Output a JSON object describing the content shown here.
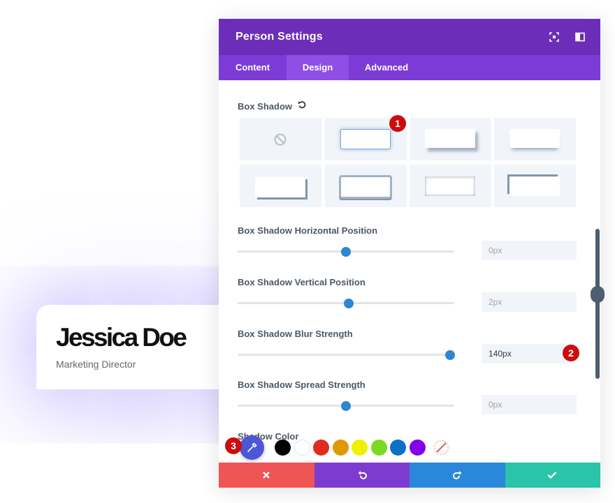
{
  "card": {
    "name": "Jessica Doe",
    "role": "Marketing Director"
  },
  "modal": {
    "title": "Person Settings",
    "header_icons": [
      "fullscreen-icon",
      "sidebar-toggle-icon"
    ],
    "tabs": [
      {
        "label": "Content",
        "active": false
      },
      {
        "label": "Design",
        "active": true
      },
      {
        "label": "Advanced",
        "active": false
      }
    ]
  },
  "box_shadow": {
    "label": "Box Shadow",
    "reset_icon": "reset-icon",
    "presets": [
      "none",
      "preset-1",
      "preset-2",
      "preset-3",
      "preset-4",
      "preset-5",
      "preset-6",
      "preset-7"
    ],
    "selected_preset": "preset-1"
  },
  "fields": {
    "horizontal": {
      "label": "Box Shadow Horizontal Position",
      "value": "0px",
      "slider_fraction": 0.5
    },
    "vertical": {
      "label": "Box Shadow Vertical Position",
      "value": "2px",
      "slider_fraction": 0.51
    },
    "blur": {
      "label": "Box Shadow Blur Strength",
      "value": "140px",
      "slider_fraction": 0.985
    },
    "spread": {
      "label": "Box Shadow Spread Strength",
      "value": "0px",
      "slider_fraction": 0.5
    }
  },
  "shadow_color": {
    "label": "Shadow Color",
    "swatches": [
      "#000000",
      "#ffffff",
      "#e02b20",
      "#e09900",
      "#edf000",
      "#7cda24",
      "#0c71c3",
      "#8300e9"
    ]
  },
  "badges": {
    "one": "1",
    "two": "2",
    "three": "3"
  },
  "footer": {
    "cancel": {
      "icon": "close-icon",
      "color": "#ef5555"
    },
    "undo": {
      "icon": "undo-icon",
      "color": "#7e3bd0"
    },
    "redo": {
      "icon": "redo-icon",
      "color": "#2b87da"
    },
    "save": {
      "icon": "check-icon",
      "color": "#29c4a9"
    }
  }
}
